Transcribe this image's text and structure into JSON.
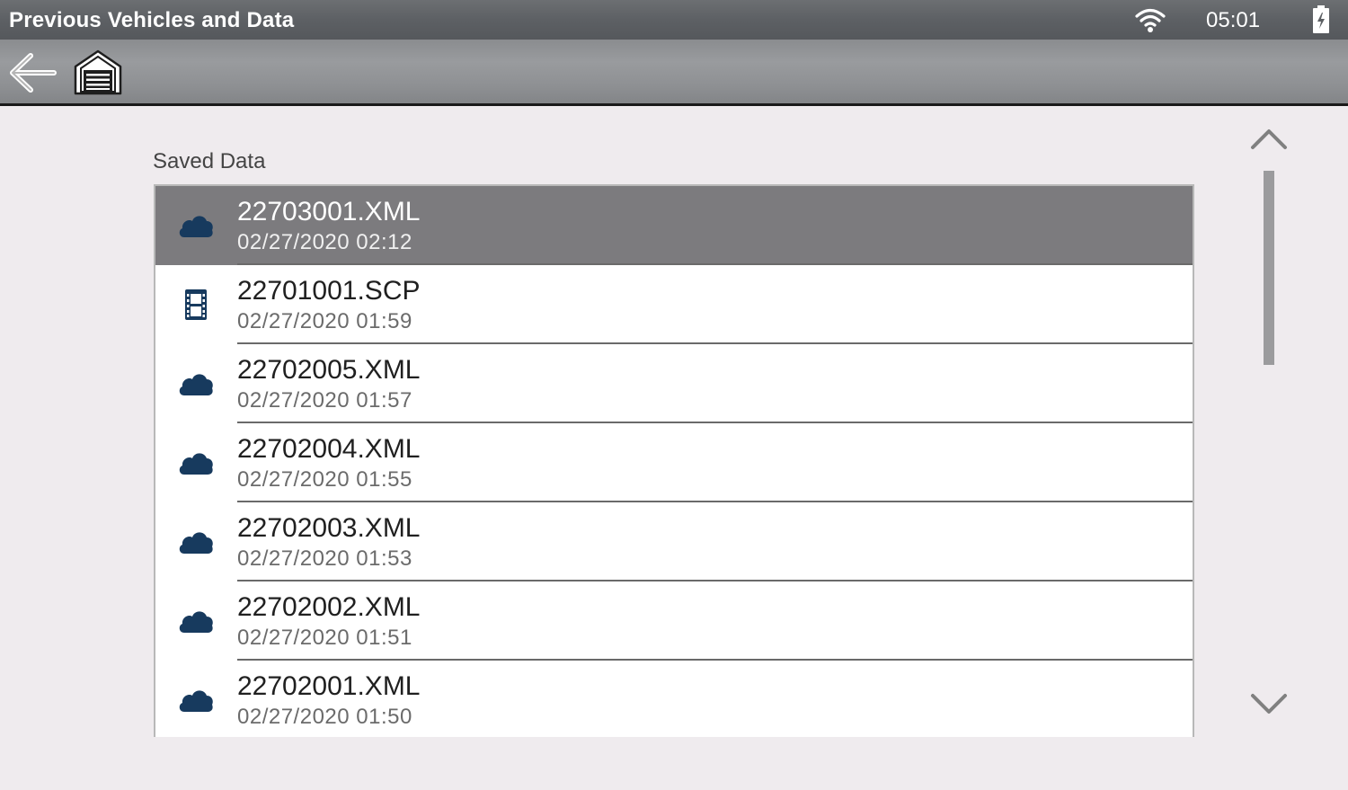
{
  "window": {
    "title": "Previous Vehicles and Data"
  },
  "status": {
    "time": "05:01",
    "wifi_icon": "wifi-icon",
    "battery_icon": "battery-charging-icon"
  },
  "toolbar": {
    "back_icon": "back-arrow-icon",
    "home_icon": "garage-home-icon"
  },
  "section": {
    "label": "Saved Data"
  },
  "files": [
    {
      "name": "22703001.XML",
      "date": "02/27/2020 02:12",
      "icon": "cloud-icon",
      "selected": true
    },
    {
      "name": "22701001.SCP",
      "date": "02/27/2020 01:59",
      "icon": "film-icon",
      "selected": false
    },
    {
      "name": "22702005.XML",
      "date": "02/27/2020 01:57",
      "icon": "cloud-icon",
      "selected": false
    },
    {
      "name": "22702004.XML",
      "date": "02/27/2020 01:55",
      "icon": "cloud-icon",
      "selected": false
    },
    {
      "name": "22702003.XML",
      "date": "02/27/2020 01:53",
      "icon": "cloud-icon",
      "selected": false
    },
    {
      "name": "22702002.XML",
      "date": "02/27/2020 01:51",
      "icon": "cloud-icon",
      "selected": false
    },
    {
      "name": "22702001.XML",
      "date": "02/27/2020 01:50",
      "icon": "cloud-icon",
      "selected": false
    }
  ],
  "colors": {
    "icon": "#173a5e",
    "selected_row": "#7c7b7e"
  }
}
